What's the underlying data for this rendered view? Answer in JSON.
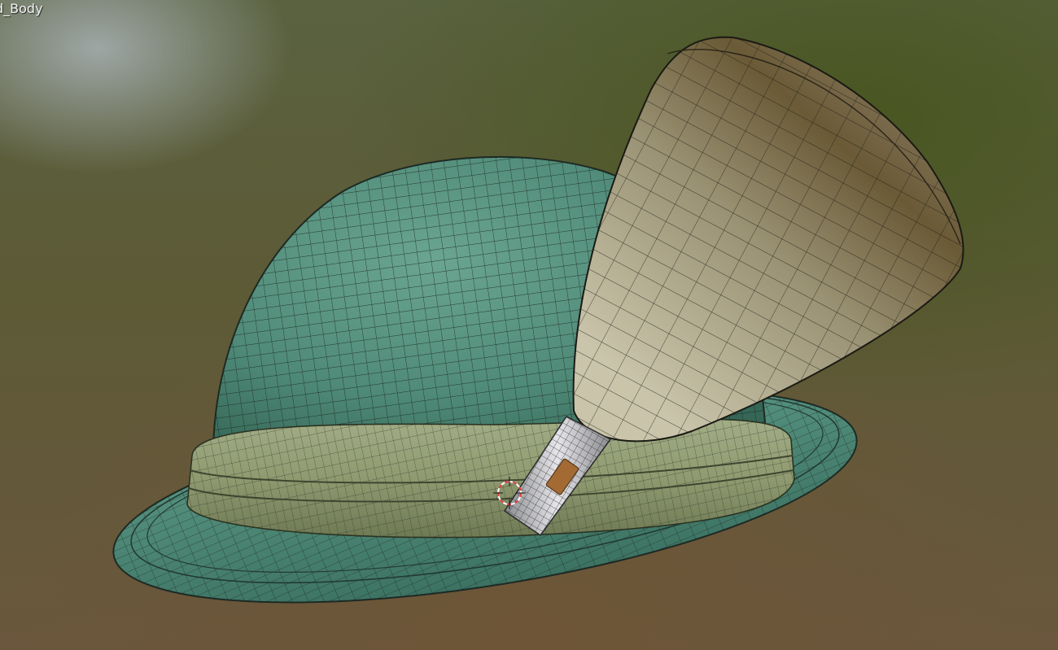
{
  "viewport": {
    "active_object_label": "d_Body"
  },
  "scene": {
    "display_mode": "wireframe-over-solid",
    "objects": [
      {
        "name": "hat-crown",
        "color": "#4f8a78"
      },
      {
        "name": "hat-brim",
        "color": "#4e8876"
      },
      {
        "name": "hat-band",
        "color": "#93a07a"
      },
      {
        "name": "feather-brush",
        "color": "#8c8468"
      },
      {
        "name": "brush-holder",
        "color": "#bfc0c4"
      },
      {
        "name": "3d-cursor",
        "color": "#e23a3a"
      }
    ],
    "wire_color": "#1a1f1a"
  }
}
